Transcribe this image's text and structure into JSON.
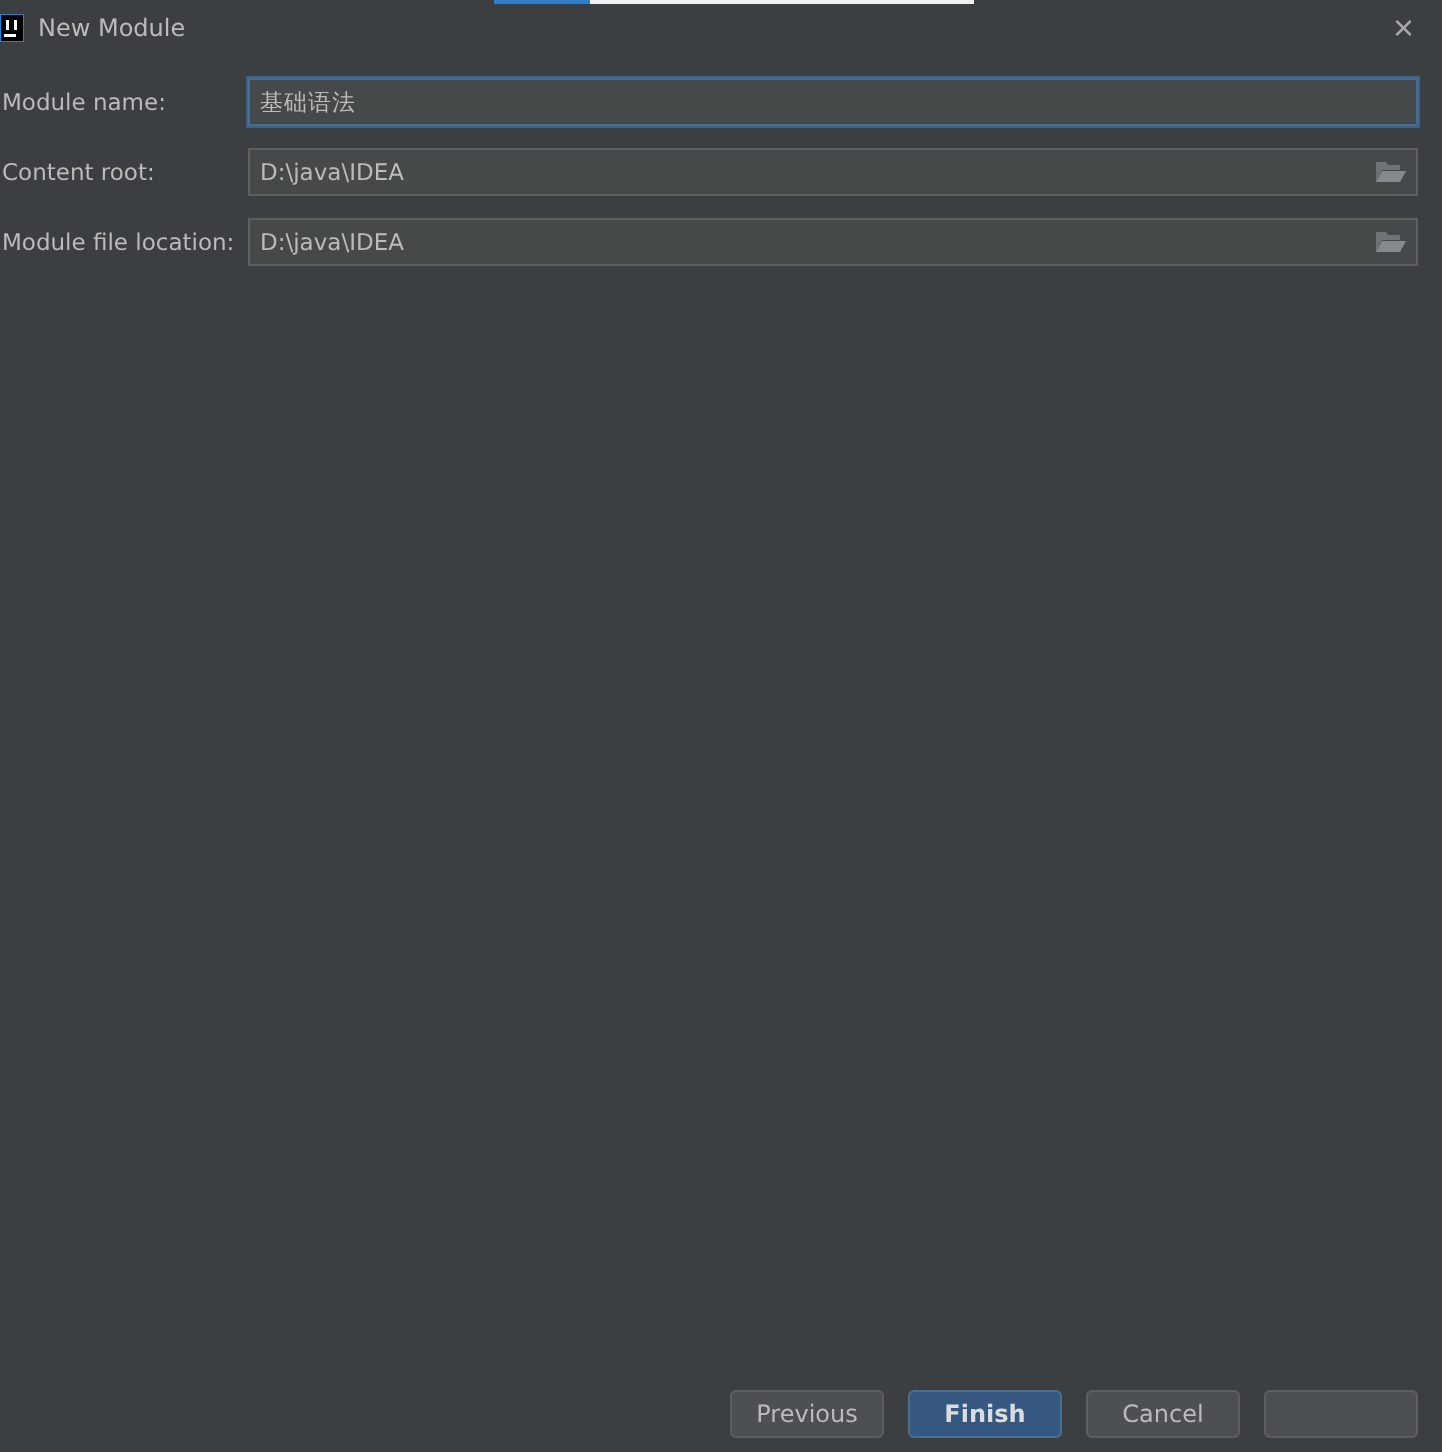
{
  "window": {
    "title": "New Module",
    "close": "×"
  },
  "fields": [
    {
      "label": "Module name:",
      "value": "基础语法",
      "focused": true,
      "browse": false
    },
    {
      "label": "Content root:",
      "value": "D:\\java\\IDEA",
      "focused": false,
      "browse": true
    },
    {
      "label": "Module file location:",
      "value": "D:\\java\\IDEA",
      "focused": false,
      "browse": true
    }
  ],
  "buttons": [
    {
      "label": "Previous",
      "primary": false
    },
    {
      "label": "Finish",
      "primary": true
    },
    {
      "label": "Cancel",
      "primary": false
    },
    {
      "primary": false
    }
  ]
}
